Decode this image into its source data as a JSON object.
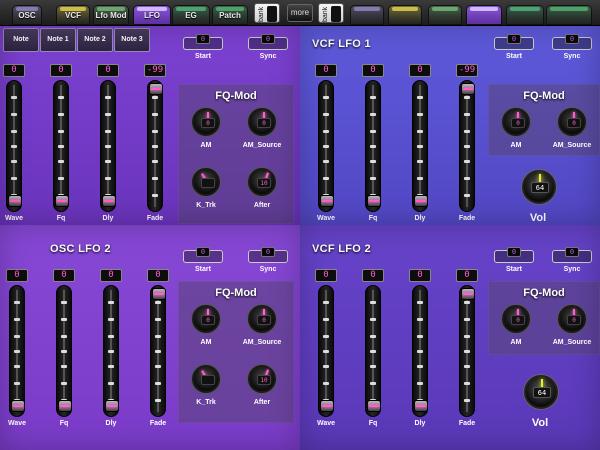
{
  "top_tabs": [
    {
      "label": "OSC",
      "color": "#8a7fb8",
      "active": false
    },
    {
      "label": "VCF",
      "color": "#d6c84a",
      "active": false
    },
    {
      "label": "Lfo Mod",
      "color": "#6fae74",
      "active": false
    },
    {
      "label": "LFO",
      "color": "#d9c3ff",
      "active": true
    },
    {
      "label": "EG",
      "color": "#4faa78",
      "active": false
    },
    {
      "label": "Patch",
      "color": "#4faa6e",
      "active": false
    }
  ],
  "right_tabs": [
    {
      "label": "",
      "color": "#8a7fb8"
    },
    {
      "label": "",
      "color": "#d6c84a"
    },
    {
      "label": "",
      "color": "#6fae74"
    },
    {
      "label": "",
      "color": "#d9c3ff"
    },
    {
      "label": "",
      "color": "#4faa78"
    },
    {
      "label": "",
      "color": "#4faa6e"
    }
  ],
  "bank1": {
    "word": "bank",
    "number": "1"
  },
  "more": {
    "label": "more"
  },
  "bank2": {
    "word": "bank",
    "number": "2"
  },
  "note_buttons": [
    "Note",
    "Note 1",
    "Note 2",
    "Note 3"
  ],
  "colors": {
    "accent": "#ff5fd0",
    "vol_accent": "#e8f030",
    "quad_purple": "#7b3fcf",
    "quad_blue": "#5b58d6"
  },
  "quads": {
    "osc_lfo_1": {
      "title": "",
      "start": {
        "label": "Start",
        "value": "0"
      },
      "sync": {
        "label": "Sync",
        "value": "0"
      },
      "faders": [
        {
          "label": "Wave",
          "value": "0",
          "level": 0.03
        },
        {
          "label": "Fq",
          "value": "0",
          "level": 0.03
        },
        {
          "label": "Dly",
          "value": "0",
          "level": 0.03
        },
        {
          "label": "Fade",
          "value": "-99",
          "level": 0.98
        }
      ],
      "fqmod": {
        "title": "FQ-Mod",
        "knobs": [
          {
            "label": "AM",
            "value": "0",
            "angle": 0
          },
          {
            "label": "AM_Source",
            "value": "0",
            "angle": 0
          },
          {
            "label": "K_Trk",
            "value": "",
            "angle": -30
          },
          {
            "label": "After",
            "value": "10",
            "angle": 20
          }
        ]
      }
    },
    "vcf_lfo_1": {
      "title": "VCF LFO 1",
      "start": {
        "label": "Start",
        "value": "0"
      },
      "sync": {
        "label": "Sync",
        "value": "0"
      },
      "faders": [
        {
          "label": "Wave",
          "value": "0",
          "level": 0.03
        },
        {
          "label": "Fq",
          "value": "0",
          "level": 0.03
        },
        {
          "label": "Dly",
          "value": "0",
          "level": 0.03
        },
        {
          "label": "Fade",
          "value": "-99",
          "level": 0.98
        }
      ],
      "fqmod": {
        "title": "FQ-Mod",
        "knobs": [
          {
            "label": "AM",
            "value": "0",
            "angle": 0
          },
          {
            "label": "AM_Source",
            "value": "0",
            "angle": 0
          }
        ]
      },
      "vol": {
        "label": "Vol",
        "value": "64",
        "angle": 0
      }
    },
    "osc_lfo_2": {
      "title": "OSC LFO 2",
      "start": {
        "label": "Start",
        "value": "0"
      },
      "sync": {
        "label": "Sync",
        "value": "0"
      },
      "faders": [
        {
          "label": "Wave",
          "value": "0",
          "level": 0.03
        },
        {
          "label": "Fq",
          "value": "0",
          "level": 0.03
        },
        {
          "label": "Dly",
          "value": "0",
          "level": 0.03
        },
        {
          "label": "Fade",
          "value": "0",
          "level": 0.98
        }
      ],
      "fqmod": {
        "title": "FQ-Mod",
        "knobs": [
          {
            "label": "AM",
            "value": "0",
            "angle": 0
          },
          {
            "label": "AM_Source",
            "value": "0",
            "angle": 0
          },
          {
            "label": "K_Trk",
            "value": "",
            "angle": -30
          },
          {
            "label": "After",
            "value": "10",
            "angle": 20
          }
        ]
      }
    },
    "vcf_lfo_2": {
      "title": "VCF LFO 2",
      "start": {
        "label": "Start",
        "value": "0"
      },
      "sync": {
        "label": "Sync",
        "value": "0"
      },
      "faders": [
        {
          "label": "Wave",
          "value": "0",
          "level": 0.03
        },
        {
          "label": "Fq",
          "value": "0",
          "level": 0.03
        },
        {
          "label": "Dly",
          "value": "0",
          "level": 0.03
        },
        {
          "label": "Fade",
          "value": "0",
          "level": 0.98
        }
      ],
      "fqmod": {
        "title": "FQ-Mod",
        "knobs": [
          {
            "label": "AM",
            "value": "0",
            "angle": 0
          },
          {
            "label": "AM_Source",
            "value": "0",
            "angle": 0
          }
        ]
      },
      "vol": {
        "label": "Vol",
        "value": "64",
        "angle": 0
      }
    }
  }
}
